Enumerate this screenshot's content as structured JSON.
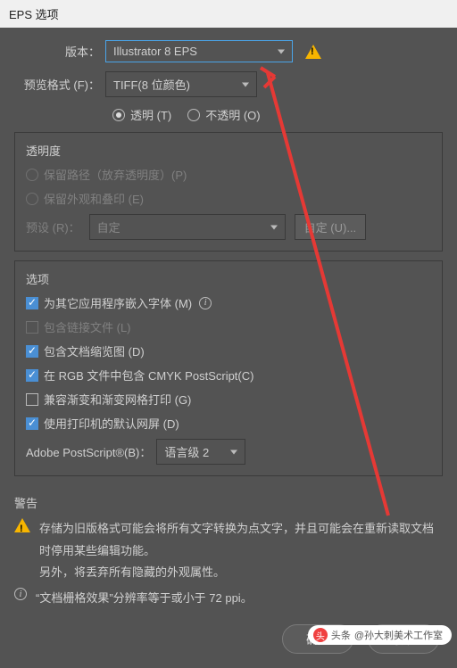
{
  "title": "EPS 选项",
  "version": {
    "label": "版本：",
    "value": "Illustrator 8 EPS"
  },
  "previewFormat": {
    "label": "预览格式 (F)：",
    "value": "TIFF(8 位颜色)"
  },
  "transparencyRadio": {
    "transparent": "透明 (T)",
    "opaque": "不透明 (O)"
  },
  "transparencyBox": {
    "title": "透明度",
    "keepPaths": "保留路径（放弃透明度）(P)",
    "keepAppearance": "保留外观和叠印 (E)",
    "presetLabel": "预设 (R)：",
    "presetValue": "自定",
    "customBtn": "自定 (U)..."
  },
  "optionsBox": {
    "title": "选项",
    "embedFonts": "为其它应用程序嵌入字体 (M)",
    "includeLinked": "包含链接文件 (L)",
    "includeThumb": "包含文档缩览图 (D)",
    "includeCMYK": "在 RGB 文件中包含 CMYK PostScript(C)",
    "compatGradient": "兼容渐变和渐变网格打印 (G)",
    "usePrinterDefault": "使用打印机的默认网屏 (D)",
    "psLabel": "Adobe PostScript®(B)：",
    "psValue": "语言级 2"
  },
  "warningsBox": {
    "title": "警告",
    "w1": "存储为旧版格式可能会将所有文字转换为点文字，并且可能会在重新读取文档时停用某些编辑功能。",
    "w2": "另外，将丢弃所有隐藏的外观属性。",
    "w3": "“文档栅格效果”分辨率等于或小于 72 ppi。"
  },
  "buttons": {
    "ok": "确定",
    "cancel": "取消"
  },
  "watermark": {
    "prefix": "头条",
    "author": "@孙大刺美术工作室"
  }
}
